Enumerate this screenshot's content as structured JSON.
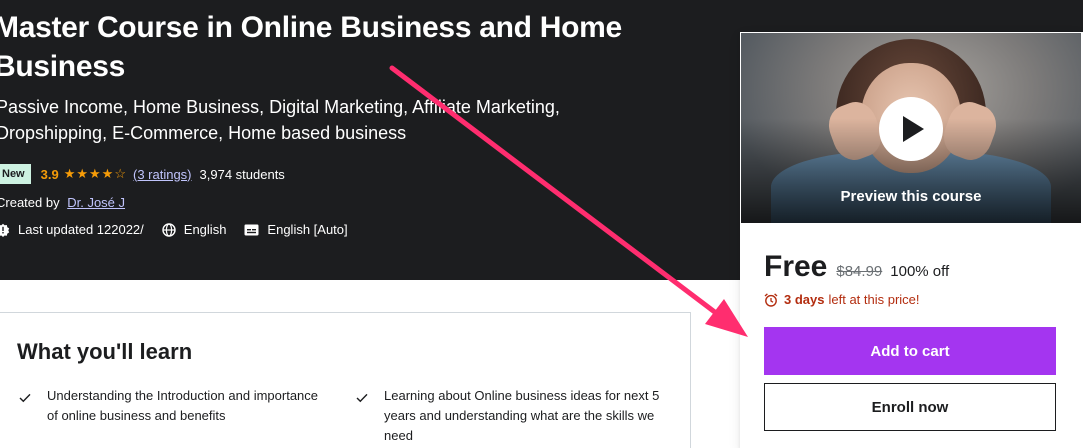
{
  "course": {
    "title": "Master Course in Online Business and Home Business",
    "subtitle": "Passive Income, Home Business, Digital Marketing, Affiliate Marketing, Dropshipping, E-Commerce, Home based business",
    "badge": "New",
    "rating": "3.9",
    "stars": "★★★★☆",
    "rating_count": "(3 ratings)",
    "students": "3,974 students",
    "created_by_label": "Created by",
    "author": "Dr. José J",
    "last_updated": "Last updated 122022/",
    "language": "English",
    "captions": "English [Auto]"
  },
  "sidebar": {
    "preview_label": "Preview this course",
    "price_now": "Free",
    "price_old": "$84.99",
    "discount": "100% off",
    "timer_days": "3 days",
    "timer_rest": "left at this price!",
    "add_to_cart": "Add to cart",
    "enroll_now": "Enroll now"
  },
  "learn": {
    "title": "What you'll learn",
    "items": [
      "Understanding the Introduction and importance of online business and benefits",
      "Learning about Online business ideas for next 5 years and understanding what are the skills we need"
    ]
  },
  "colors": {
    "header_bg": "#1c1d1f",
    "accent_purple": "#a435f0",
    "star_orange": "#f69c08",
    "timer_red": "#b32d0f",
    "annotation_pink": "#ff2d6f"
  },
  "icons": [
    "alert-badge-icon",
    "globe-icon",
    "captions-icon",
    "play-icon",
    "alarm-clock-icon",
    "check-icon"
  ]
}
